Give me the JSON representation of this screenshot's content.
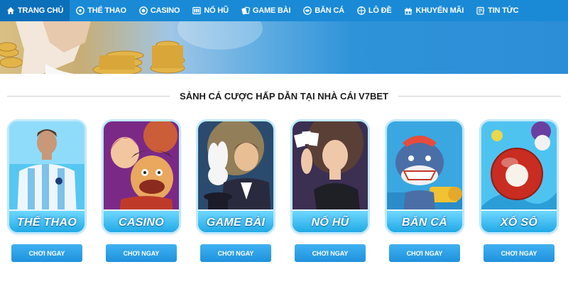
{
  "nav": {
    "items": [
      {
        "label": "TRANG CHỦ",
        "icon": "home-icon",
        "active": true
      },
      {
        "label": "THỂ THAO",
        "icon": "soccer-ball-icon"
      },
      {
        "label": "CASINO",
        "icon": "casino-chip-icon"
      },
      {
        "label": "NỔ HŨ",
        "icon": "slot-machine-icon"
      },
      {
        "label": "GAME BÀI",
        "icon": "playing-cards-icon"
      },
      {
        "label": "BẮN CÁ",
        "icon": "fish-globe-icon"
      },
      {
        "label": "LÔ ĐỀ",
        "icon": "lottery-ball-icon"
      },
      {
        "label": "KHUYẾN MÃI",
        "icon": "gift-icon"
      },
      {
        "label": "TIN TỨC",
        "icon": "news-icon"
      }
    ],
    "color": "#1a8ad6"
  },
  "banner": {
    "slides": 2,
    "active_slide": 1
  },
  "section": {
    "title": "SẢNH CÁ CƯỢC HẤP DẪN TẠI NHÀ CÁI V7BET"
  },
  "cards": [
    {
      "label": "THỂ THAO",
      "button": "CHƠI NGAY",
      "icon": "football-player-image"
    },
    {
      "label": "CASINO",
      "button": "CHƠI NGAY",
      "icon": "casino-characters-image"
    },
    {
      "label": "GAME BÀI",
      "button": "CHƠI NGAY",
      "icon": "magician-image"
    },
    {
      "label": "NỔ HŨ",
      "button": "CHƠI NGAY",
      "icon": "woman-cards-image"
    },
    {
      "label": "BẮN CÁ",
      "button": "CHƠI NGAY",
      "icon": "shark-image"
    },
    {
      "label": "XỔ SỐ",
      "button": "CHƠI NGAY",
      "icon": "lottery-ball-image"
    }
  ],
  "colors": {
    "accent": "#1a8ad6",
    "card": "#3ec0ee",
    "button": "#1f92dd"
  }
}
